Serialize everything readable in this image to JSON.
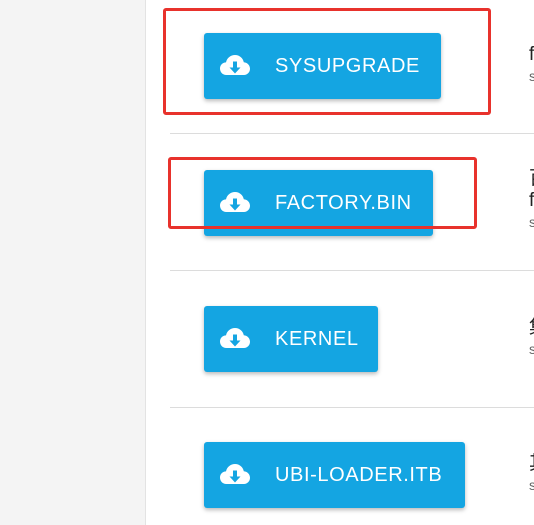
{
  "colors": {
    "button": "#14a5e2",
    "highlight": "#e8322c",
    "sidebar": "#f4f4f4"
  },
  "downloads": [
    {
      "label": "SYSUPGRADE",
      "icon": "cloud-download-icon",
      "side_title": "f",
      "side_sub": "s"
    },
    {
      "label": "FACTORY.BIN",
      "icon": "cloud-download-icon",
      "side_title": "百",
      "side_title2": "f",
      "side_sub": "s"
    },
    {
      "label": "KERNEL",
      "icon": "cloud-download-icon",
      "side_title": "集",
      "side_sub": "s"
    },
    {
      "label": "UBI-LOADER.ITB",
      "icon": "cloud-download-icon",
      "side_title": "其",
      "side_sub": "s"
    }
  ]
}
